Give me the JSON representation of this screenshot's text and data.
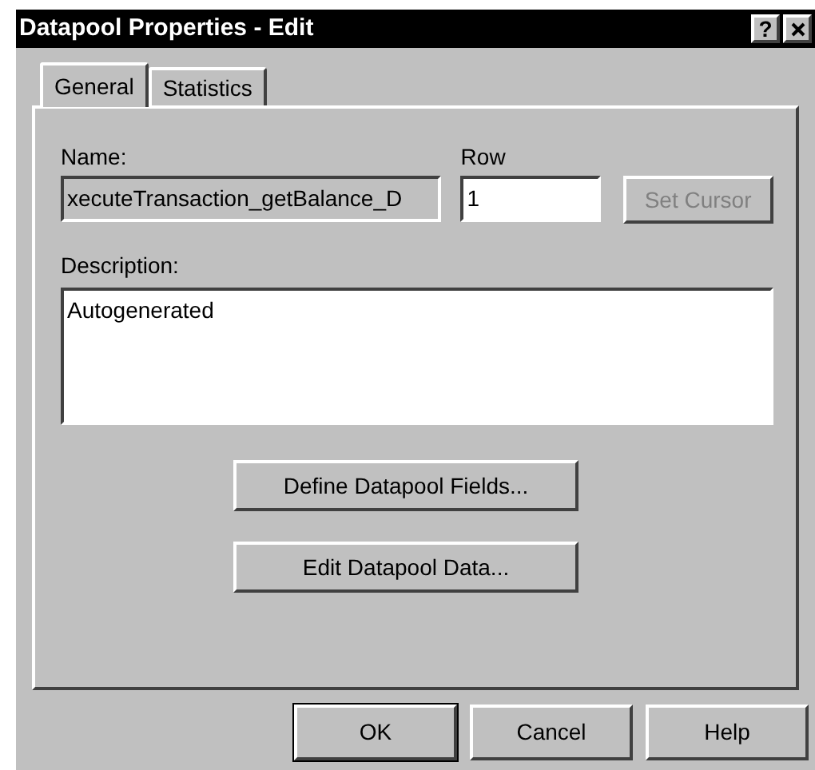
{
  "window": {
    "title": "Datapool Properties - Edit",
    "title_buttons": [
      {
        "kind": "help",
        "label": "?"
      },
      {
        "kind": "close"
      }
    ]
  },
  "tabs": [
    {
      "label": "General",
      "selected": true
    },
    {
      "label": "Statistics",
      "selected": false
    }
  ],
  "name": {
    "label": "Name:",
    "value": "xecuteTransaction_getBalance_D",
    "disabled": true
  },
  "row": {
    "label": "Row",
    "value": "1"
  },
  "set_cursor": {
    "label": "Set Cursor",
    "disabled": true
  },
  "description": {
    "label": "Description:",
    "value": "Autogenerated"
  },
  "actions": [
    {
      "label": "Define Datapool Fields..."
    },
    {
      "label": "Edit Datapool Data..."
    }
  ],
  "buttons": [
    {
      "label": "OK",
      "default": true
    },
    {
      "label": "Cancel",
      "default": false
    },
    {
      "label": "Help",
      "default": false
    }
  ]
}
